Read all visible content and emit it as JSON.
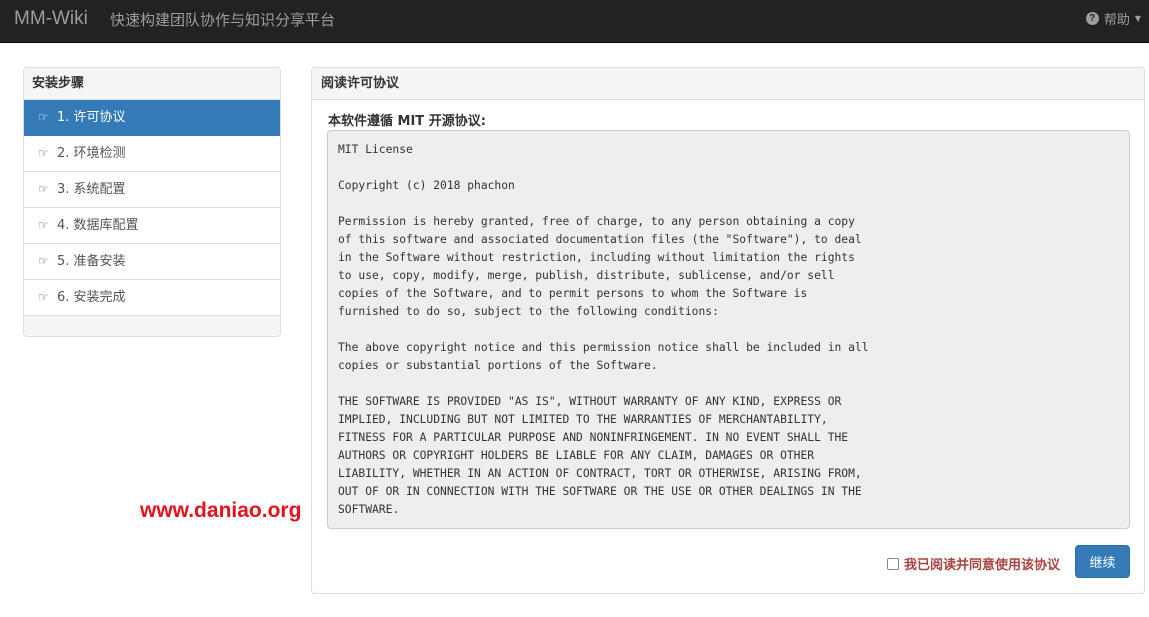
{
  "navbar": {
    "brand": "MM-Wiki",
    "tagline": "快速构建团队协作与知识分享平台",
    "help_label": "帮助",
    "help_icon": "question-circle-icon"
  },
  "steps": {
    "heading": "安装步骤",
    "items": [
      {
        "label": "1. 许可协议",
        "active": true
      },
      {
        "label": "2. 环境检测",
        "active": false
      },
      {
        "label": "3. 系统配置",
        "active": false
      },
      {
        "label": "4. 数据库配置",
        "active": false
      },
      {
        "label": "5. 准备安装",
        "active": false
      },
      {
        "label": "6. 安装完成",
        "active": false
      }
    ]
  },
  "main": {
    "heading": "阅读许可协议",
    "license_label": "本软件遵循 MIT 开源协议:",
    "license_text": "MIT License\n\nCopyright (c) 2018 phachon\n\nPermission is hereby granted, free of charge, to any person obtaining a copy\nof this software and associated documentation files (the \"Software\"), to deal\nin the Software without restriction, including without limitation the rights\nto use, copy, modify, merge, publish, distribute, sublicense, and/or sell\ncopies of the Software, and to permit persons to whom the Software is\nfurnished to do so, subject to the following conditions:\n\nThe above copyright notice and this permission notice shall be included in all\ncopies or substantial portions of the Software.\n\nTHE SOFTWARE IS PROVIDED \"AS IS\", WITHOUT WARRANTY OF ANY KIND, EXPRESS OR\nIMPLIED, INCLUDING BUT NOT LIMITED TO THE WARRANTIES OF MERCHANTABILITY,\nFITNESS FOR A PARTICULAR PURPOSE AND NONINFRINGEMENT. IN NO EVENT SHALL THE\nAUTHORS OR COPYRIGHT HOLDERS BE LIABLE FOR ANY CLAIM, DAMAGES OR OTHER\nLIABILITY, WHETHER IN AN ACTION OF CONTRACT, TORT OR OTHERWISE, ARISING FROM,\nOUT OF OR IN CONNECTION WITH THE SOFTWARE OR THE USE OR OTHER DEALINGS IN THE\nSOFTWARE.",
    "agree_label": "我已阅读并同意使用该协议",
    "agree_checked": false,
    "continue_label": "继续"
  },
  "watermark": "www.daniao.org",
  "colors": {
    "navbar_bg": "#222222",
    "primary": "#337ab7",
    "agree_text": "#a94442",
    "watermark": "#e4121b"
  }
}
